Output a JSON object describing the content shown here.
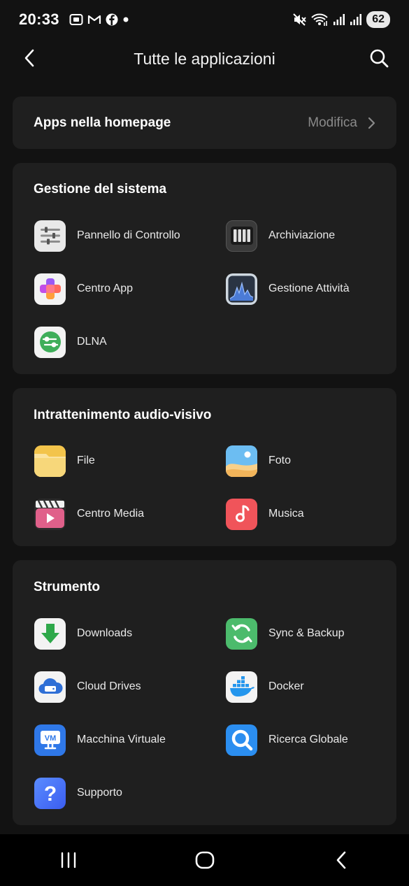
{
  "status": {
    "time": "20:33",
    "battery": "62",
    "notification_icons": [
      "screenshot-icon",
      "gmail-icon",
      "facebook-icon",
      "dot-icon"
    ],
    "right_icons": [
      "mute-icon",
      "wifi-icon",
      "signal-icon",
      "signal-icon"
    ]
  },
  "header": {
    "title": "Tutte le applicazioni",
    "back_icon": "chevron-left-icon",
    "search_icon": "search-icon"
  },
  "homepage": {
    "label": "Apps nella homepage",
    "action": "Modifica"
  },
  "sections": [
    {
      "title": "Gestione del sistema",
      "apps": [
        {
          "label": "Pannello di Controllo",
          "icon": "control-panel-icon"
        },
        {
          "label": "Archiviazione",
          "icon": "storage-icon"
        },
        {
          "label": "Centro App",
          "icon": "app-center-icon"
        },
        {
          "label": "Gestione Attività",
          "icon": "task-manager-icon"
        },
        {
          "label": "DLNA",
          "icon": "dlna-icon"
        }
      ]
    },
    {
      "title": "Intrattenimento audio-visivo",
      "apps": [
        {
          "label": "File",
          "icon": "folder-icon"
        },
        {
          "label": "Foto",
          "icon": "photos-icon"
        },
        {
          "label": "Centro Media",
          "icon": "media-center-icon"
        },
        {
          "label": "Musica",
          "icon": "music-icon"
        }
      ]
    },
    {
      "title": "Strumento",
      "apps": [
        {
          "label": "Downloads",
          "icon": "download-icon"
        },
        {
          "label": "Sync & Backup",
          "icon": "sync-backup-icon"
        },
        {
          "label": "Cloud Drives",
          "icon": "cloud-drive-icon"
        },
        {
          "label": "Docker",
          "icon": "docker-icon"
        },
        {
          "label": "Macchina Virtuale",
          "icon": "virtual-machine-icon",
          "icon_text": "VM"
        },
        {
          "label": "Ricerca Globale",
          "icon": "global-search-icon"
        },
        {
          "label": "Supporto",
          "icon": "help-icon",
          "icon_text": "?"
        }
      ]
    }
  ],
  "nav": {
    "recents_icon": "recents-icon",
    "home_icon": "home-icon",
    "back_icon": "back-icon"
  },
  "colors": {
    "background": "#121212",
    "card": "#1f1f1f",
    "muted_text": "#8a8a8a"
  }
}
